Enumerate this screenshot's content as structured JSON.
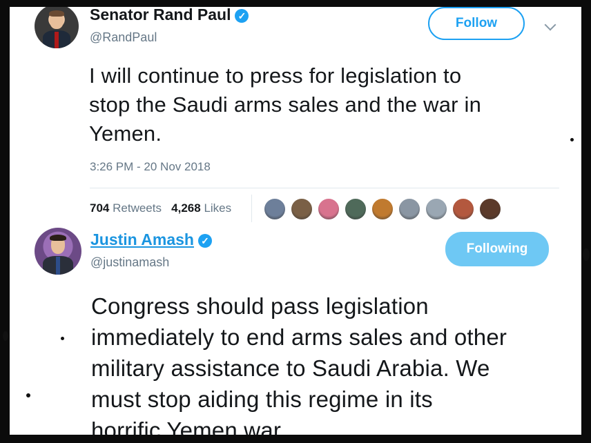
{
  "tweets": [
    {
      "display_name": "Senator Rand Paul",
      "handle": "@RandPaul",
      "button_label": "Follow",
      "text_lines": [
        "I will continue to press for legislation to",
        "stop the Saudi arms sales and the war in",
        "Yemen."
      ],
      "timestamp": "3:26 PM - 20 Nov 2018",
      "retweets_count": "704",
      "retweets_label": "Retweets",
      "likes_count": "4,268",
      "likes_label": "Likes",
      "liker_avatar_colors": [
        "#6d7f9a",
        "#7a6046",
        "#d8738e",
        "#4f6a5a",
        "#c07a2f",
        "#8a96a3",
        "#9aa7b3",
        "#b3583e",
        "#5b3a2a"
      ]
    },
    {
      "display_name": "Justin Amash",
      "handle": "@justinamash",
      "button_label": "Following",
      "text_lines": [
        "Congress should pass legislation",
        "immediately to end arms sales and other",
        "military assistance to Saudi Arabia. We",
        "must stop aiding this regime in its",
        "horrific Yemen war."
      ]
    }
  ],
  "colors": {
    "brand_blue": "#1da1f2",
    "following_bg": "#6ec8f4",
    "text_primary": "#14171a",
    "text_secondary": "#657786"
  },
  "icons": {
    "verified": "verified-badge-icon",
    "dropdown": "chevron-down-icon"
  }
}
